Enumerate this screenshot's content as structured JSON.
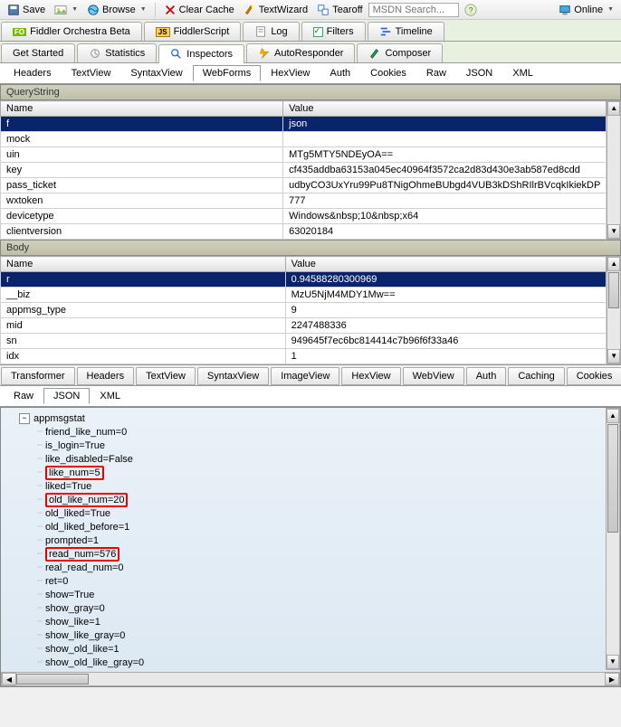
{
  "toolbar": {
    "save": "Save",
    "browse": "Browse",
    "clear_cache": "Clear Cache",
    "textwizard": "TextWizard",
    "tearoff": "Tearoff",
    "msdn_placeholder": "MSDN Search...",
    "online": "Online"
  },
  "tabs_row1": {
    "fiddler_orchestra": "Fiddler Orchestra Beta",
    "fiddlerscript": "FiddlerScript",
    "log": "Log",
    "filters": "Filters",
    "timeline": "Timeline"
  },
  "tabs_row2": {
    "get_started": "Get Started",
    "statistics": "Statistics",
    "inspectors": "Inspectors",
    "autoresponder": "AutoResponder",
    "composer": "Composer"
  },
  "req_tabs": [
    "Headers",
    "TextView",
    "SyntaxView",
    "WebForms",
    "HexView",
    "Auth",
    "Cookies",
    "Raw",
    "JSON",
    "XML"
  ],
  "req_active": "WebForms",
  "querystring": {
    "title": "QueryString",
    "col_name": "Name",
    "col_value": "Value",
    "rows": [
      {
        "n": "f",
        "v": "json",
        "sel": true
      },
      {
        "n": "mock",
        "v": ""
      },
      {
        "n": "uin",
        "v": "MTg5MTY5NDEyOA=="
      },
      {
        "n": "key",
        "v": "cf435addba63153a045ec40964f3572ca2d83d430e3ab587ed8cdd"
      },
      {
        "n": "pass_ticket",
        "v": "udbyCO3UxYru99Pu8TNigOhmeBUbgd4VUB3kDShRIlrBVcqkIkiekDP"
      },
      {
        "n": "wxtoken",
        "v": "777"
      },
      {
        "n": "devicetype",
        "v": "Windows&nbsp;10&nbsp;x64"
      },
      {
        "n": "clientversion",
        "v": "63020184"
      }
    ]
  },
  "body": {
    "title": "Body",
    "col_name": "Name",
    "col_value": "Value",
    "rows": [
      {
        "n": "r",
        "v": "0.94588280300969",
        "sel": true
      },
      {
        "n": "__biz",
        "v": "MzU5NjM4MDY1Mw=="
      },
      {
        "n": "appmsg_type",
        "v": "9"
      },
      {
        "n": "mid",
        "v": "2247488336"
      },
      {
        "n": "sn",
        "v": "949645f7ec6bc814414c7b96f6f33a46"
      },
      {
        "n": "idx",
        "v": "1"
      }
    ]
  },
  "resp_tabs": [
    "Transformer",
    "Headers",
    "TextView",
    "SyntaxView",
    "ImageView",
    "HexView",
    "WebView",
    "Auth",
    "Caching",
    "Cookies"
  ],
  "resp_subtabs": [
    "Raw",
    "JSON",
    "XML"
  ],
  "resp_sub_active": "JSON",
  "tree": {
    "root": "appmsgstat",
    "items": [
      {
        "t": "friend_like_num=0"
      },
      {
        "t": "is_login=True"
      },
      {
        "t": "like_disabled=False"
      },
      {
        "t": "like_num=5",
        "hl": true
      },
      {
        "t": "liked=True"
      },
      {
        "t": "old_like_num=20",
        "hl": true
      },
      {
        "t": "old_liked=True"
      },
      {
        "t": "old_liked_before=1"
      },
      {
        "t": "prompted=1"
      },
      {
        "t": "read_num=576",
        "hl": true
      },
      {
        "t": "real_read_num=0"
      },
      {
        "t": "ret=0"
      },
      {
        "t": "show=True"
      },
      {
        "t": "show_gray=0"
      },
      {
        "t": "show_like=1"
      },
      {
        "t": "show_like_gray=0"
      },
      {
        "t": "show_old_like=1"
      },
      {
        "t": "show_old_like_gray=0"
      }
    ]
  },
  "chart_data": {
    "type": "table",
    "title": "appmsgstat JSON values",
    "columns": [
      "key",
      "value"
    ],
    "rows": [
      [
        "friend_like_num",
        0
      ],
      [
        "is_login",
        true
      ],
      [
        "like_disabled",
        false
      ],
      [
        "like_num",
        5
      ],
      [
        "liked",
        true
      ],
      [
        "old_like_num",
        20
      ],
      [
        "old_liked",
        true
      ],
      [
        "old_liked_before",
        1
      ],
      [
        "prompted",
        1
      ],
      [
        "read_num",
        576
      ],
      [
        "real_read_num",
        0
      ],
      [
        "ret",
        0
      ],
      [
        "show",
        true
      ],
      [
        "show_gray",
        0
      ],
      [
        "show_like",
        1
      ],
      [
        "show_like_gray",
        0
      ],
      [
        "show_old_like",
        1
      ],
      [
        "show_old_like_gray",
        0
      ]
    ]
  }
}
